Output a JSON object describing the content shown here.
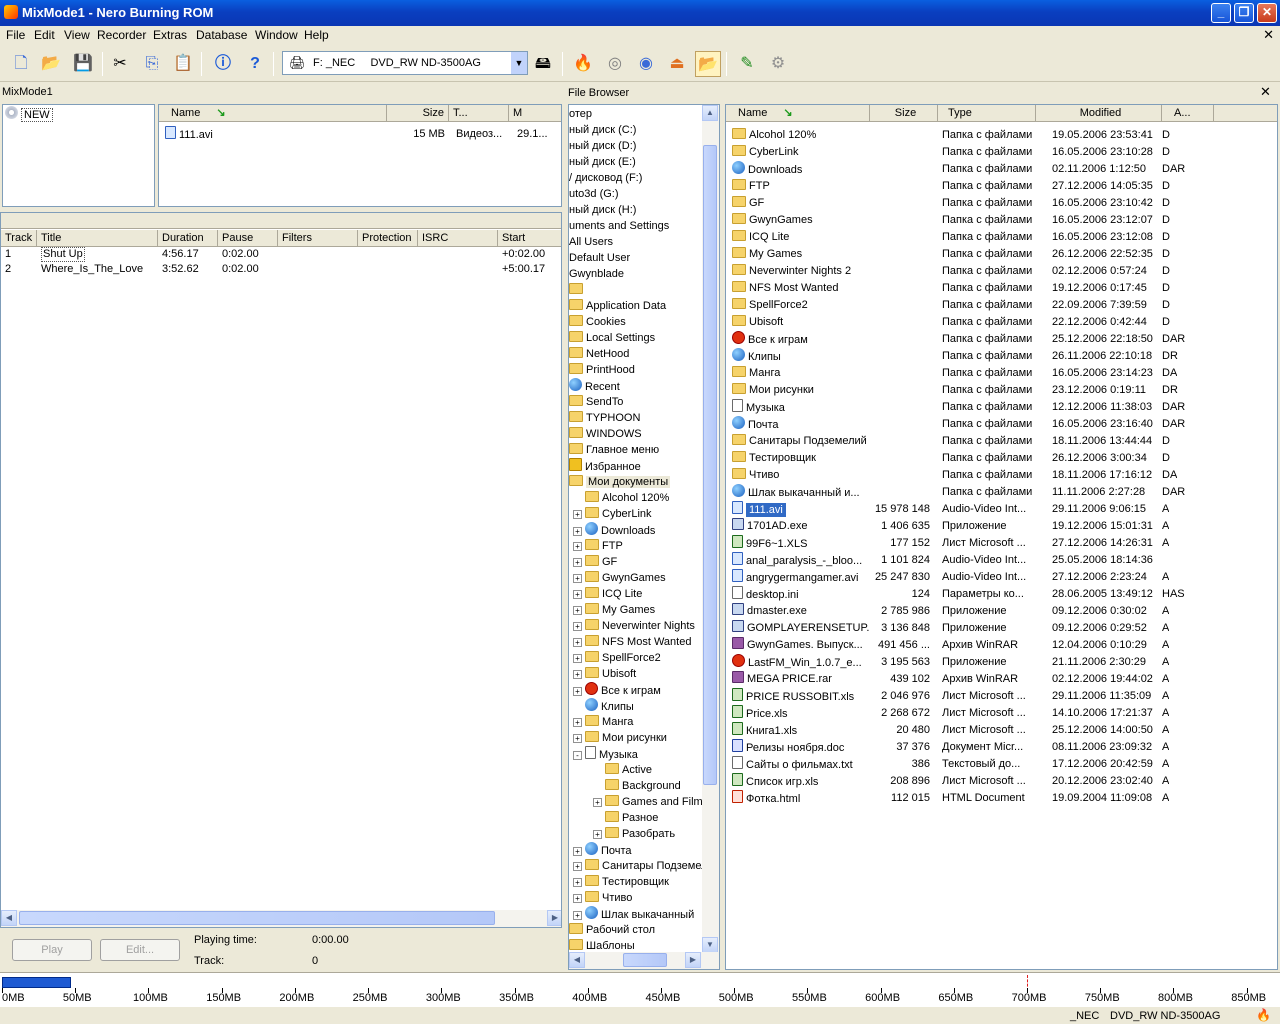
{
  "window": {
    "title": "MixMode1 - Nero Burning ROM"
  },
  "menu": [
    "File",
    "Edit",
    "View",
    "Recorder",
    "Extras",
    "Database",
    "Window",
    "Help"
  ],
  "toolbar": {
    "drive": "F: _NEC     DVD_RW ND-3500AG"
  },
  "compilation": {
    "label": "MixMode1",
    "tree_root": "NEW",
    "columns": [
      "Name",
      "Size",
      "T...",
      "M"
    ],
    "files": [
      {
        "name": "111.avi",
        "size": "15 MB",
        "type": "Видеоз...",
        "mod": "29.1..."
      }
    ]
  },
  "tracks": {
    "columns": [
      "Track",
      "Title",
      "Duration",
      "Pause",
      "Filters",
      "Protection",
      "ISRC",
      "Start"
    ],
    "rows": [
      {
        "track": "1",
        "title": "Shut Up",
        "duration": "4:56.17",
        "pause": "0:02.00",
        "start": "+0:02.00"
      },
      {
        "track": "2",
        "title": "Where_Is_The_Love",
        "duration": "3:52.62",
        "pause": "0:02.00",
        "start": "+5:00.17"
      }
    ]
  },
  "player": {
    "play": "Play",
    "edit": "Edit...",
    "playing_label": "Playing time:",
    "playing_value": "0:00.00",
    "track_label": "Track:",
    "track_value": "0"
  },
  "browser": {
    "title": "File Browser",
    "tree": [
      {
        "t": "отер",
        "l": 0,
        "i": "none"
      },
      {
        "t": "ный диск (C:)",
        "l": 0,
        "i": "none"
      },
      {
        "t": "ный диск (D:)",
        "l": 0,
        "i": "none"
      },
      {
        "t": "ный диск (E:)",
        "l": 0,
        "i": "none"
      },
      {
        "t": "/ дисковод (F:)",
        "l": 0,
        "i": "none"
      },
      {
        "t": "uto3d (G:)",
        "l": 0,
        "i": "none"
      },
      {
        "t": "ный диск (H:)",
        "l": 0,
        "i": "none"
      },
      {
        "t": "uments and Settings",
        "l": 0,
        "i": "none"
      },
      {
        "t": "All Users",
        "l": 0,
        "i": "none"
      },
      {
        "t": "Default User",
        "l": 0,
        "i": "none"
      },
      {
        "t": "Gwynblade",
        "l": 0,
        "i": "none"
      },
      {
        "t": "",
        "l": 0,
        "i": "folder"
      },
      {
        "t": "Application Data",
        "l": 0,
        "i": "folder"
      },
      {
        "t": "Cookies",
        "l": 0,
        "i": "folder"
      },
      {
        "t": "Local Settings",
        "l": 0,
        "i": "folder"
      },
      {
        "t": "NetHood",
        "l": 0,
        "i": "folder"
      },
      {
        "t": "PrintHood",
        "l": 0,
        "i": "folder"
      },
      {
        "t": "Recent",
        "l": 0,
        "i": "globe"
      },
      {
        "t": "SendTo",
        "l": 0,
        "i": "folder"
      },
      {
        "t": "TYPHOON",
        "l": 0,
        "i": "folder"
      },
      {
        "t": "WINDOWS",
        "l": 0,
        "i": "folder"
      },
      {
        "t": "Главное меню",
        "l": 0,
        "i": "folder"
      },
      {
        "t": "Избранное",
        "l": 0,
        "i": "star"
      },
      {
        "t": "Мои документы",
        "l": 0,
        "i": "folder",
        "sel": true
      },
      {
        "t": "Alcohol 120%",
        "l": 1,
        "i": "folder"
      },
      {
        "t": "CyberLink",
        "l": 1,
        "i": "folder",
        "e": "+"
      },
      {
        "t": "Downloads",
        "l": 1,
        "i": "globe",
        "e": "+"
      },
      {
        "t": "FTP",
        "l": 1,
        "i": "folder",
        "e": "+"
      },
      {
        "t": "GF",
        "l": 1,
        "i": "folder",
        "e": "+"
      },
      {
        "t": "GwynGames",
        "l": 1,
        "i": "folder",
        "e": "+"
      },
      {
        "t": "ICQ Lite",
        "l": 1,
        "i": "folder",
        "e": "+"
      },
      {
        "t": "My Games",
        "l": 1,
        "i": "folder",
        "e": "+"
      },
      {
        "t": "Neverwinter Nights",
        "l": 1,
        "i": "folder",
        "e": "+"
      },
      {
        "t": "NFS Most Wanted",
        "l": 1,
        "i": "folder",
        "e": "+"
      },
      {
        "t": "SpellForce2",
        "l": 1,
        "i": "folder",
        "e": "+"
      },
      {
        "t": "Ubisoft",
        "l": 1,
        "i": "folder",
        "e": "+"
      },
      {
        "t": "Все к играм",
        "l": 1,
        "i": "red",
        "e": "+"
      },
      {
        "t": "Клипы",
        "l": 1,
        "i": "globe"
      },
      {
        "t": "Манга",
        "l": 1,
        "i": "folder",
        "e": "+"
      },
      {
        "t": "Мои рисунки",
        "l": 1,
        "i": "folder",
        "e": "+"
      },
      {
        "t": "Музыка",
        "l": 1,
        "i": "file",
        "e": "-"
      },
      {
        "t": "Active",
        "l": 2,
        "i": "folder"
      },
      {
        "t": "Background",
        "l": 2,
        "i": "folder"
      },
      {
        "t": "Games and Films",
        "l": 2,
        "i": "folder",
        "e": "+"
      },
      {
        "t": "Разное",
        "l": 2,
        "i": "folder"
      },
      {
        "t": "Разобрать",
        "l": 2,
        "i": "folder",
        "e": "+"
      },
      {
        "t": "Почта",
        "l": 1,
        "i": "globe",
        "e": "+"
      },
      {
        "t": "Санитары Подземелий",
        "l": 1,
        "i": "folder",
        "e": "+"
      },
      {
        "t": "Тестировщик",
        "l": 1,
        "i": "folder",
        "e": "+"
      },
      {
        "t": "Чтиво",
        "l": 1,
        "i": "folder",
        "e": "+"
      },
      {
        "t": "Шлак выкачанный",
        "l": 1,
        "i": "globe",
        "e": "+"
      },
      {
        "t": "Рабочий стол",
        "l": 0,
        "i": "folder"
      },
      {
        "t": "Шаблоны",
        "l": 0,
        "i": "folder"
      }
    ],
    "columns": [
      "Name",
      "Size",
      "Type",
      "Modified",
      "A..."
    ],
    "files": [
      {
        "n": "Alcohol 120%",
        "s": "",
        "t": "Папка с файлами",
        "m": "19.05.2006 23:53:41",
        "a": "D",
        "i": "folder"
      },
      {
        "n": "CyberLink",
        "s": "",
        "t": "Папка с файлами",
        "m": "16.05.2006 23:10:28",
        "a": "D",
        "i": "folder"
      },
      {
        "n": "Downloads",
        "s": "",
        "t": "Папка с файлами",
        "m": "02.11.2006 1:12:50",
        "a": "DAR",
        "i": "globe"
      },
      {
        "n": "FTP",
        "s": "",
        "t": "Папка с файлами",
        "m": "27.12.2006 14:05:35",
        "a": "D",
        "i": "folder"
      },
      {
        "n": "GF",
        "s": "",
        "t": "Папка с файлами",
        "m": "16.05.2006 23:10:42",
        "a": "D",
        "i": "folder"
      },
      {
        "n": "GwynGames",
        "s": "",
        "t": "Папка с файлами",
        "m": "16.05.2006 23:12:07",
        "a": "D",
        "i": "folder"
      },
      {
        "n": "ICQ Lite",
        "s": "",
        "t": "Папка с файлами",
        "m": "16.05.2006 23:12:08",
        "a": "D",
        "i": "folder"
      },
      {
        "n": "My Games",
        "s": "",
        "t": "Папка с файлами",
        "m": "26.12.2006 22:52:35",
        "a": "D",
        "i": "folder"
      },
      {
        "n": "Neverwinter Nights 2",
        "s": "",
        "t": "Папка с файлами",
        "m": "02.12.2006 0:57:24",
        "a": "D",
        "i": "folder"
      },
      {
        "n": "NFS Most Wanted",
        "s": "",
        "t": "Папка с файлами",
        "m": "19.12.2006 0:17:45",
        "a": "D",
        "i": "folder"
      },
      {
        "n": "SpellForce2",
        "s": "",
        "t": "Папка с файлами",
        "m": "22.09.2006 7:39:59",
        "a": "D",
        "i": "folder"
      },
      {
        "n": "Ubisoft",
        "s": "",
        "t": "Папка с файлами",
        "m": "22.12.2006 0:42:44",
        "a": "D",
        "i": "folder"
      },
      {
        "n": "Все к играм",
        "s": "",
        "t": "Папка с файлами",
        "m": "25.12.2006 22:18:50",
        "a": "DAR",
        "i": "red"
      },
      {
        "n": "Клипы",
        "s": "",
        "t": "Папка с файлами",
        "m": "26.11.2006 22:10:18",
        "a": "DR",
        "i": "globe"
      },
      {
        "n": "Манга",
        "s": "",
        "t": "Папка с файлами",
        "m": "16.05.2006 23:14:23",
        "a": "DA",
        "i": "folder"
      },
      {
        "n": "Мои рисунки",
        "s": "",
        "t": "Папка с файлами",
        "m": "23.12.2006 0:19:11",
        "a": "DR",
        "i": "folder"
      },
      {
        "n": "Музыка",
        "s": "",
        "t": "Папка с файлами",
        "m": "12.12.2006 11:38:03",
        "a": "DAR",
        "i": "file"
      },
      {
        "n": "Почта",
        "s": "",
        "t": "Папка с файлами",
        "m": "16.05.2006 23:16:40",
        "a": "DAR",
        "i": "globe"
      },
      {
        "n": "Санитары Подземелий",
        "s": "",
        "t": "Папка с файлами",
        "m": "18.11.2006 13:44:44",
        "a": "D",
        "i": "folder"
      },
      {
        "n": "Тестировщик",
        "s": "",
        "t": "Папка с файлами",
        "m": "26.12.2006 3:00:34",
        "a": "D",
        "i": "folder"
      },
      {
        "n": "Чтиво",
        "s": "",
        "t": "Папка с файлами",
        "m": "18.11.2006 17:16:12",
        "a": "DA",
        "i": "folder"
      },
      {
        "n": "Шлак выкачанный и...",
        "s": "",
        "t": "Папка с файлами",
        "m": "11.11.2006 2:27:28",
        "a": "DAR",
        "i": "globe"
      },
      {
        "n": "111.avi",
        "s": "15 978 148",
        "t": "Audio-Video Int...",
        "m": "29.11.2006 9:06:15",
        "a": "A",
        "i": "avi",
        "sel": true
      },
      {
        "n": "1701AD.exe",
        "s": "1 406 635",
        "t": "Приложение",
        "m": "19.12.2006 15:01:31",
        "a": "A",
        "i": "exe"
      },
      {
        "n": "99F6~1.XLS",
        "s": "177 152",
        "t": "Лист Microsoft ...",
        "m": "27.12.2006 14:26:31",
        "a": "A",
        "i": "xls"
      },
      {
        "n": "anal_paralysis_-_bloo...",
        "s": "1 101 824",
        "t": "Audio-Video Int...",
        "m": "25.05.2006 18:14:36",
        "a": "",
        "i": "avi"
      },
      {
        "n": "angrygermangamer.avi",
        "s": "25 247 830",
        "t": "Audio-Video Int...",
        "m": "27.12.2006 2:23:24",
        "a": "A",
        "i": "avi"
      },
      {
        "n": "desktop.ini",
        "s": "124",
        "t": "Параметры ко...",
        "m": "28.06.2005 13:49:12",
        "a": "HAS",
        "i": "file"
      },
      {
        "n": "dmaster.exe",
        "s": "2 785 986",
        "t": "Приложение",
        "m": "09.12.2006 0:30:02",
        "a": "A",
        "i": "exe"
      },
      {
        "n": "GOMPLAYERENSETUP....",
        "s": "3 136 848",
        "t": "Приложение",
        "m": "09.12.2006 0:29:52",
        "a": "A",
        "i": "exe"
      },
      {
        "n": "GwynGames. Выпуск...",
        "s": "491 456 ...",
        "t": "Архив WinRAR",
        "m": "12.04.2006 0:10:29",
        "a": "A",
        "i": "rar"
      },
      {
        "n": "LastFM_Win_1.0.7_e...",
        "s": "3 195 563",
        "t": "Приложение",
        "m": "21.11.2006 2:30:29",
        "a": "A",
        "i": "red"
      },
      {
        "n": "MEGA PRICE.rar",
        "s": "439 102",
        "t": "Архив WinRAR",
        "m": "02.12.2006 19:44:02",
        "a": "A",
        "i": "rar"
      },
      {
        "n": "PRICE RUSSOBIT.xls",
        "s": "2 046 976",
        "t": "Лист Microsoft ...",
        "m": "29.11.2006 11:35:09",
        "a": "A",
        "i": "xls"
      },
      {
        "n": "Price.xls",
        "s": "2 268 672",
        "t": "Лист Microsoft ...",
        "m": "14.10.2006 17:21:37",
        "a": "A",
        "i": "xls"
      },
      {
        "n": "Книга1.xls",
        "s": "20 480",
        "t": "Лист Microsoft ...",
        "m": "25.12.2006 14:00:50",
        "a": "A",
        "i": "xls"
      },
      {
        "n": "Релизы ноября.doc",
        "s": "37 376",
        "t": "Документ Micr...",
        "m": "08.11.2006 23:09:32",
        "a": "A",
        "i": "doc"
      },
      {
        "n": "Сайты о фильмах.txt",
        "s": "386",
        "t": "Текстовый до...",
        "m": "17.12.2006 20:42:59",
        "a": "A",
        "i": "file"
      },
      {
        "n": "Список игр.xls",
        "s": "208 896",
        "t": "Лист Microsoft ...",
        "m": "20.12.2006 23:02:40",
        "a": "A",
        "i": "xls"
      },
      {
        "n": "Фотка.html",
        "s": "112 015",
        "t": "HTML Document",
        "m": "19.09.2004 11:09:08",
        "a": "A",
        "i": "html"
      }
    ]
  },
  "capacity": {
    "ticks": [
      "0MB",
      "50MB",
      "100MB",
      "150MB",
      "200MB",
      "250MB",
      "300MB",
      "350MB",
      "400MB",
      "450MB",
      "500MB",
      "550MB",
      "600MB",
      "650MB",
      "700MB",
      "750MB",
      "800MB",
      "850MB"
    ],
    "used_mb": 47,
    "max_mb": 870,
    "marker_mb": 700,
    "bar_color": "#1e5ad2"
  },
  "status": {
    "drive": "_NEC",
    "model": "DVD_RW ND-3500AG"
  }
}
